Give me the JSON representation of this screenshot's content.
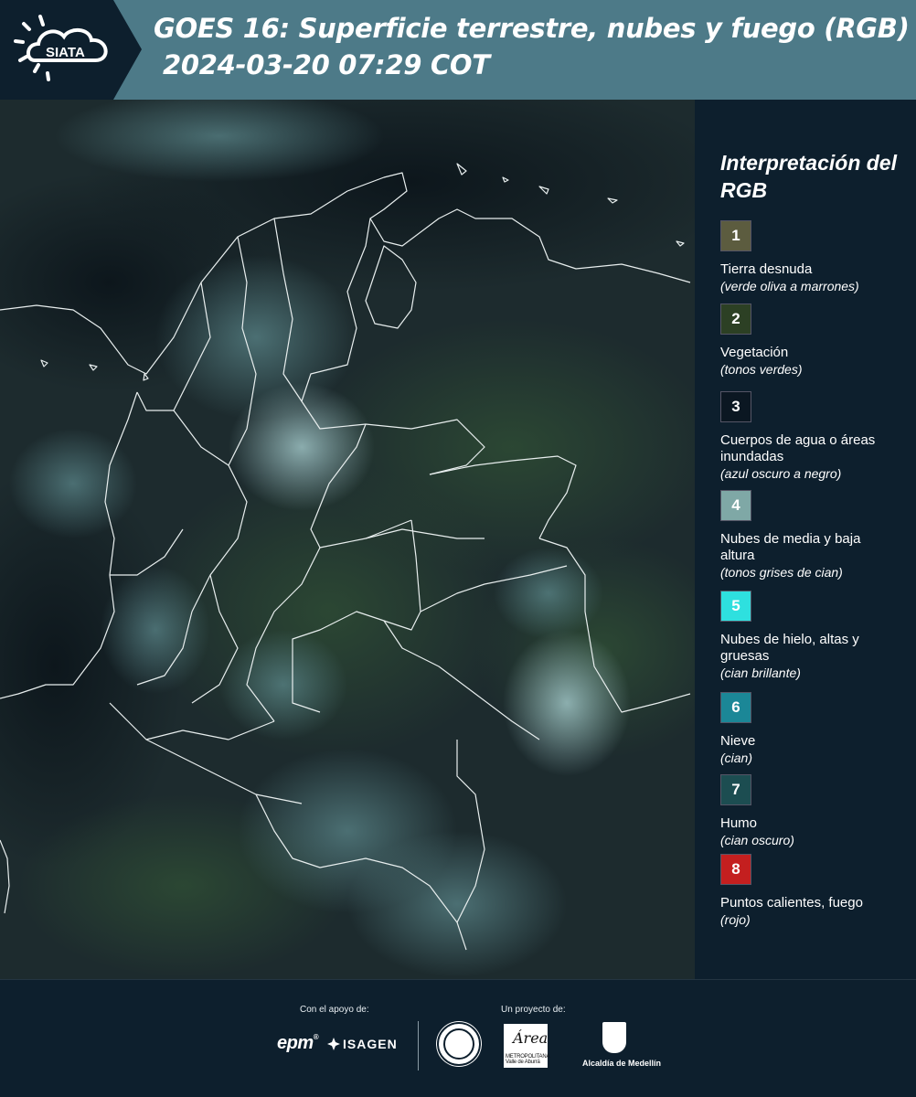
{
  "header": {
    "logo_text": "SIATA",
    "title_line1": "GOES 16: Superficie terrestre, nubes y fuego (RGB)",
    "title_line2": "2024-03-20 07:29 COT",
    "background_color": "#4d7a88"
  },
  "legend": {
    "title": "Interpretación del RGB",
    "items": [
      {
        "number": "1",
        "label": "Tierra desnuda",
        "desc": "(verde oliva a marrones)",
        "color": "#5c5c3f"
      },
      {
        "number": "2",
        "label": "Vegetación",
        "desc": "(tonos verdes)",
        "color": "#2c4024"
      },
      {
        "number": "3",
        "label": "Cuerpos de agua o áreas inundadas",
        "desc": "(azul oscuro a negro)",
        "color": "#0b1722"
      },
      {
        "number": "4",
        "label": "Nubes de media y baja altura",
        "desc": "(tonos grises de cian)",
        "color": "#7fa8a6"
      },
      {
        "number": "5",
        "label": "Nubes de hielo, altas y gruesas",
        "desc": "(cian brillante)",
        "color": "#2ee0df"
      },
      {
        "number": "6",
        "label": "Nieve",
        "desc": "(cian)",
        "color": "#1b8797"
      },
      {
        "number": "7",
        "label": "Humo",
        "desc": "(cian oscuro)",
        "color": "#1c4d51"
      },
      {
        "number": "8",
        "label": "Puntos calientes, fuego",
        "desc": "(rojo)",
        "color": "#c41f1f"
      }
    ]
  },
  "footer": {
    "support_caption": "Con el apoyo de:",
    "project_caption": "Un proyecto de:",
    "sponsors": {
      "epm": "epm",
      "isagen": "ISAGEN",
      "area_word": "Área",
      "area_sub": "METROPOLITANA Valle de Aburrá",
      "medellin": "Alcaldía de Medellín"
    }
  }
}
